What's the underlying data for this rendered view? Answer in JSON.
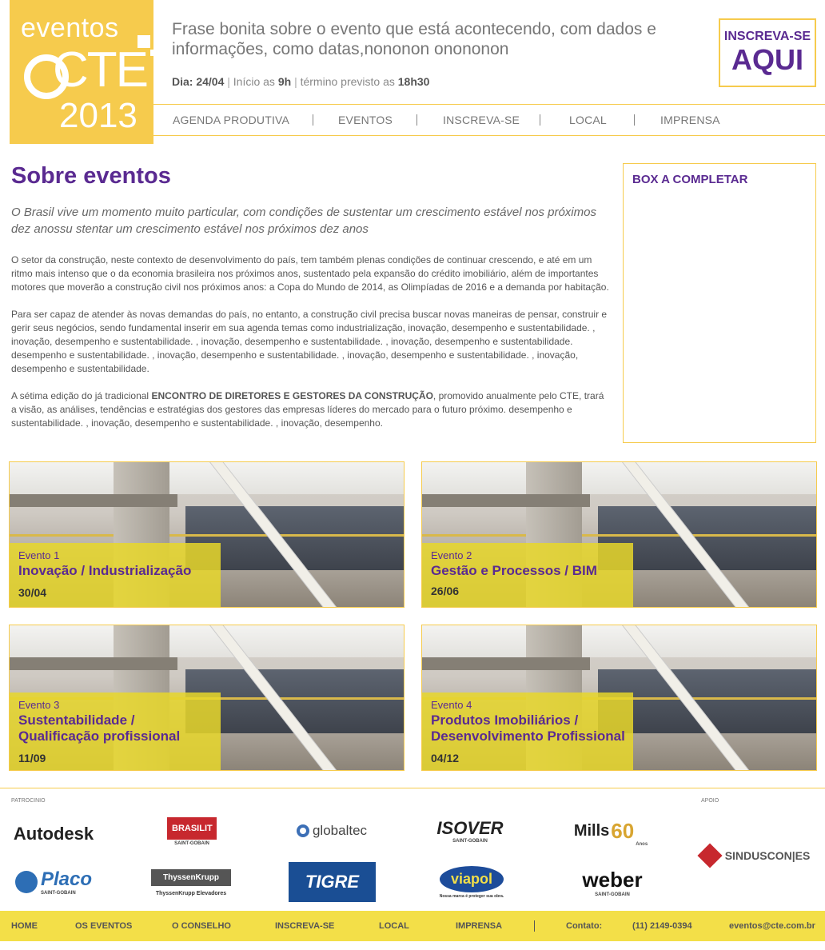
{
  "logo": {
    "line1": "eventos",
    "line2": "CTE",
    "line3": "2013"
  },
  "header": {
    "tagline": "Frase bonita sobre o evento que está acontecendo, com dados e informações, como datas,nononon onononon",
    "day_label": "Dia: 24/04",
    "start_text": "Início as",
    "start_time": "9h",
    "end_text": "término previsto as",
    "end_time": "18h30"
  },
  "signup": {
    "line1": "INSCREVA-SE",
    "line2": "AQUI"
  },
  "nav": [
    "AGENDA PRODUTIVA",
    "EVENTOS",
    "INSCREVA-SE",
    "LOCAL",
    "IMPRENSA"
  ],
  "main": {
    "title": "Sobre eventos",
    "lead": "O Brasil vive um momento muito particular, com condições de sustentar um crescimento estável nos próximos dez anossu stentar um crescimento estável nos próximos dez anos",
    "p1": "O setor da construção, neste contexto de desenvolvimento do país, tem também plenas condições de continuar crescendo, e até em um ritmo mais intenso que o da economia brasileira nos próximos anos, sustentado pela expansão do crédito imobiliário, além de importantes motores que moverão a construção civil nos próximos anos: a Copa do Mundo de 2014, as Olimpíadas de 2016 e a demanda por habitação.",
    "p2": "Para ser capaz de atender às novas demandas do país, no entanto, a construção civil precisa buscar novas maneiras de pensar, construir e gerir seus negócios, sendo fundamental inserir em sua agenda temas como industrialização, inovação, desempenho e sustentabilidade. , inovação, desempenho e sustentabilidade. , inovação, desempenho e sustentabilidade. , inovação, desempenho e sustentabilidade. desempenho e sustentabilidade. , inovação, desempenho e sustentabilidade. , inovação, desempenho e sustentabilidade. , inovação, desempenho e sustentabilidade.",
    "p3_pre": "A sétima edição do já tradicional ",
    "p3_bold": "ENCONTRO DE DIRETORES E GESTORES DA CONSTRUÇÃO",
    "p3_post": ", promovido anualmente pelo CTE, trará a visão, as análises, tendências e estratégias dos gestores das empresas líderes do mercado para o futuro próximo. desempenho e sustentabilidade. , inovação, desempenho e sustentabilidade. , inovação, desempenho."
  },
  "box": {
    "title": "BOX A COMPLETAR"
  },
  "events": [
    {
      "num": "Evento 1",
      "title": "Inovação / Industrialização",
      "date": "30/04"
    },
    {
      "num": "Evento 2",
      "title": "Gestão e Processos / BIM",
      "date": "26/06"
    },
    {
      "num": "Evento 3",
      "title": "Sustentabilidade / Qualificação profissional",
      "date": "11/09"
    },
    {
      "num": "Evento 4",
      "title": "Produtos Imobiliários / Desenvolvimento Profissional",
      "date": "04/12"
    }
  ],
  "sponsors": {
    "label": "PATROCINIO",
    "support_label": "APOIO",
    "items": [
      "Autodesk",
      "BRASILIT",
      "SAINT-GOBAIN",
      "globaltec",
      "ISOVER",
      "SAINT-GOBAIN",
      "Mills",
      "60",
      "Anos",
      "Placo",
      "SAINT-GOBAIN",
      "ThyssenKrupp",
      "ThyssenKrupp Elevadores",
      "TIGRE",
      "viapol",
      "Nossa marca é proteger sua obra.",
      "weber",
      "SAINT-GOBAIN"
    ],
    "support": "SINDUSCON|ES"
  },
  "footer": {
    "links": [
      "HOME",
      "OS EVENTOS",
      "O CONSELHO",
      "INSCREVA-SE",
      "LOCAL",
      "IMPRENSA"
    ],
    "contact_label": "Contato:",
    "phone": "(11) 2149-0394",
    "email": "eventos@cte.com.br"
  },
  "colors": {
    "yellow": "#f6cb4d",
    "purple": "#5a2a91",
    "footer": "#f3df48"
  }
}
